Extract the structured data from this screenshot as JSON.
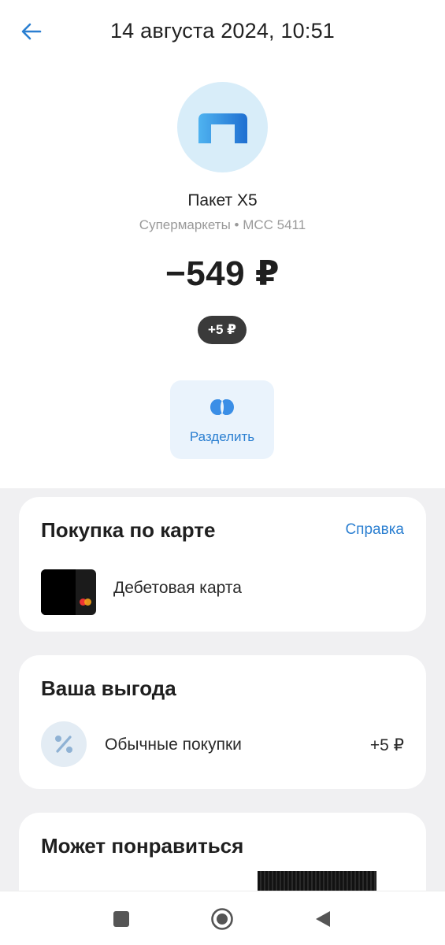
{
  "header": {
    "back_icon": "arrow-left-icon",
    "title": "14 августа 2024, 10:51"
  },
  "merchant": {
    "logo_icon": "x5-paket-logo",
    "name": "Пакет X5",
    "subtitle": "Супермаркеты • MCC 5411",
    "amount": "−549 ₽",
    "cashback": "+5 ₽"
  },
  "actions": {
    "split_icon": "split-icon",
    "split_label": "Разделить"
  },
  "purchase_card": {
    "title": "Покупка по карте",
    "help_label": "Справка",
    "card_name": "Дебетовая карта"
  },
  "benefit_card": {
    "title": "Ваша выгода",
    "icon": "percent-icon",
    "item_label": "Обычные покупки",
    "item_value": "+5 ₽"
  },
  "recommend_card": {
    "title": "Может понравиться"
  },
  "navbar": {
    "items": [
      "recent-apps-icon",
      "home-icon",
      "back-triangle-icon"
    ]
  },
  "colors": {
    "accent": "#2b7fd1",
    "logo_bg": "#d8edf9",
    "badge_bg": "#3a3a3a",
    "page_bg": "#f0f0f2"
  }
}
